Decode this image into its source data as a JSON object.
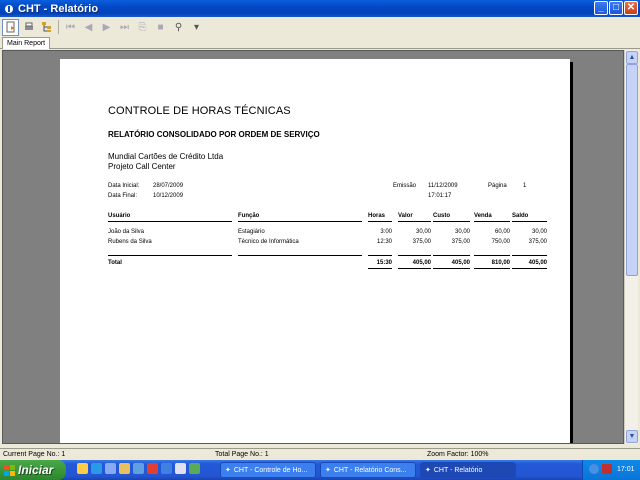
{
  "window": {
    "title": "CHT - Relatório"
  },
  "tabs": [
    {
      "label": "Main Report"
    }
  ],
  "report": {
    "title": "CONTROLE DE HORAS TÉCNICAS",
    "subtitle": "RELATÓRIO CONSOLIDADO POR ORDEM DE SERVIÇO",
    "company": "Mundial Cartões de Crédito Ltda",
    "project": "Projeto Call Center",
    "data_inicial_label": "Data Inicial:",
    "data_inicial": "28/07/2009",
    "data_final_label": "Data Final:",
    "data_final": "10/12/2009",
    "emissao_label": "Emissão",
    "emissao_date": "11/12/2009",
    "emissao_time": "17:01:17",
    "pagina_label": "Página",
    "pagina": "1",
    "columns": [
      "Usuário",
      "Função",
      "Horas",
      "Valor",
      "Custo",
      "Venda",
      "Saldo"
    ],
    "rows": [
      {
        "usuario": "João da Silva",
        "funcao": "Estagiário",
        "horas": "3:00",
        "valor": "30,00",
        "custo": "30,00",
        "venda": "60,00",
        "saldo": "30,00"
      },
      {
        "usuario": "Rubens da Silva",
        "funcao": "Técnico de Informática",
        "horas": "12:30",
        "valor": "375,00",
        "custo": "375,00",
        "venda": "750,00",
        "saldo": "375,00"
      }
    ],
    "total": {
      "label": "Total",
      "horas": "15:30",
      "valor": "405,00",
      "custo": "405,00",
      "venda": "810,00",
      "saldo": "405,00"
    }
  },
  "status": {
    "current_page": "Current Page No.: 1",
    "total_page": "Total Page No.: 1",
    "zoom": "Zoom Factor: 100%"
  },
  "taskbar": {
    "start_label": "Iniciar",
    "tasks": [
      "CHT - Controle de Ho...",
      "CHT - Relatório Cons...",
      "CHT - Relatório"
    ],
    "clock": "17:01"
  }
}
